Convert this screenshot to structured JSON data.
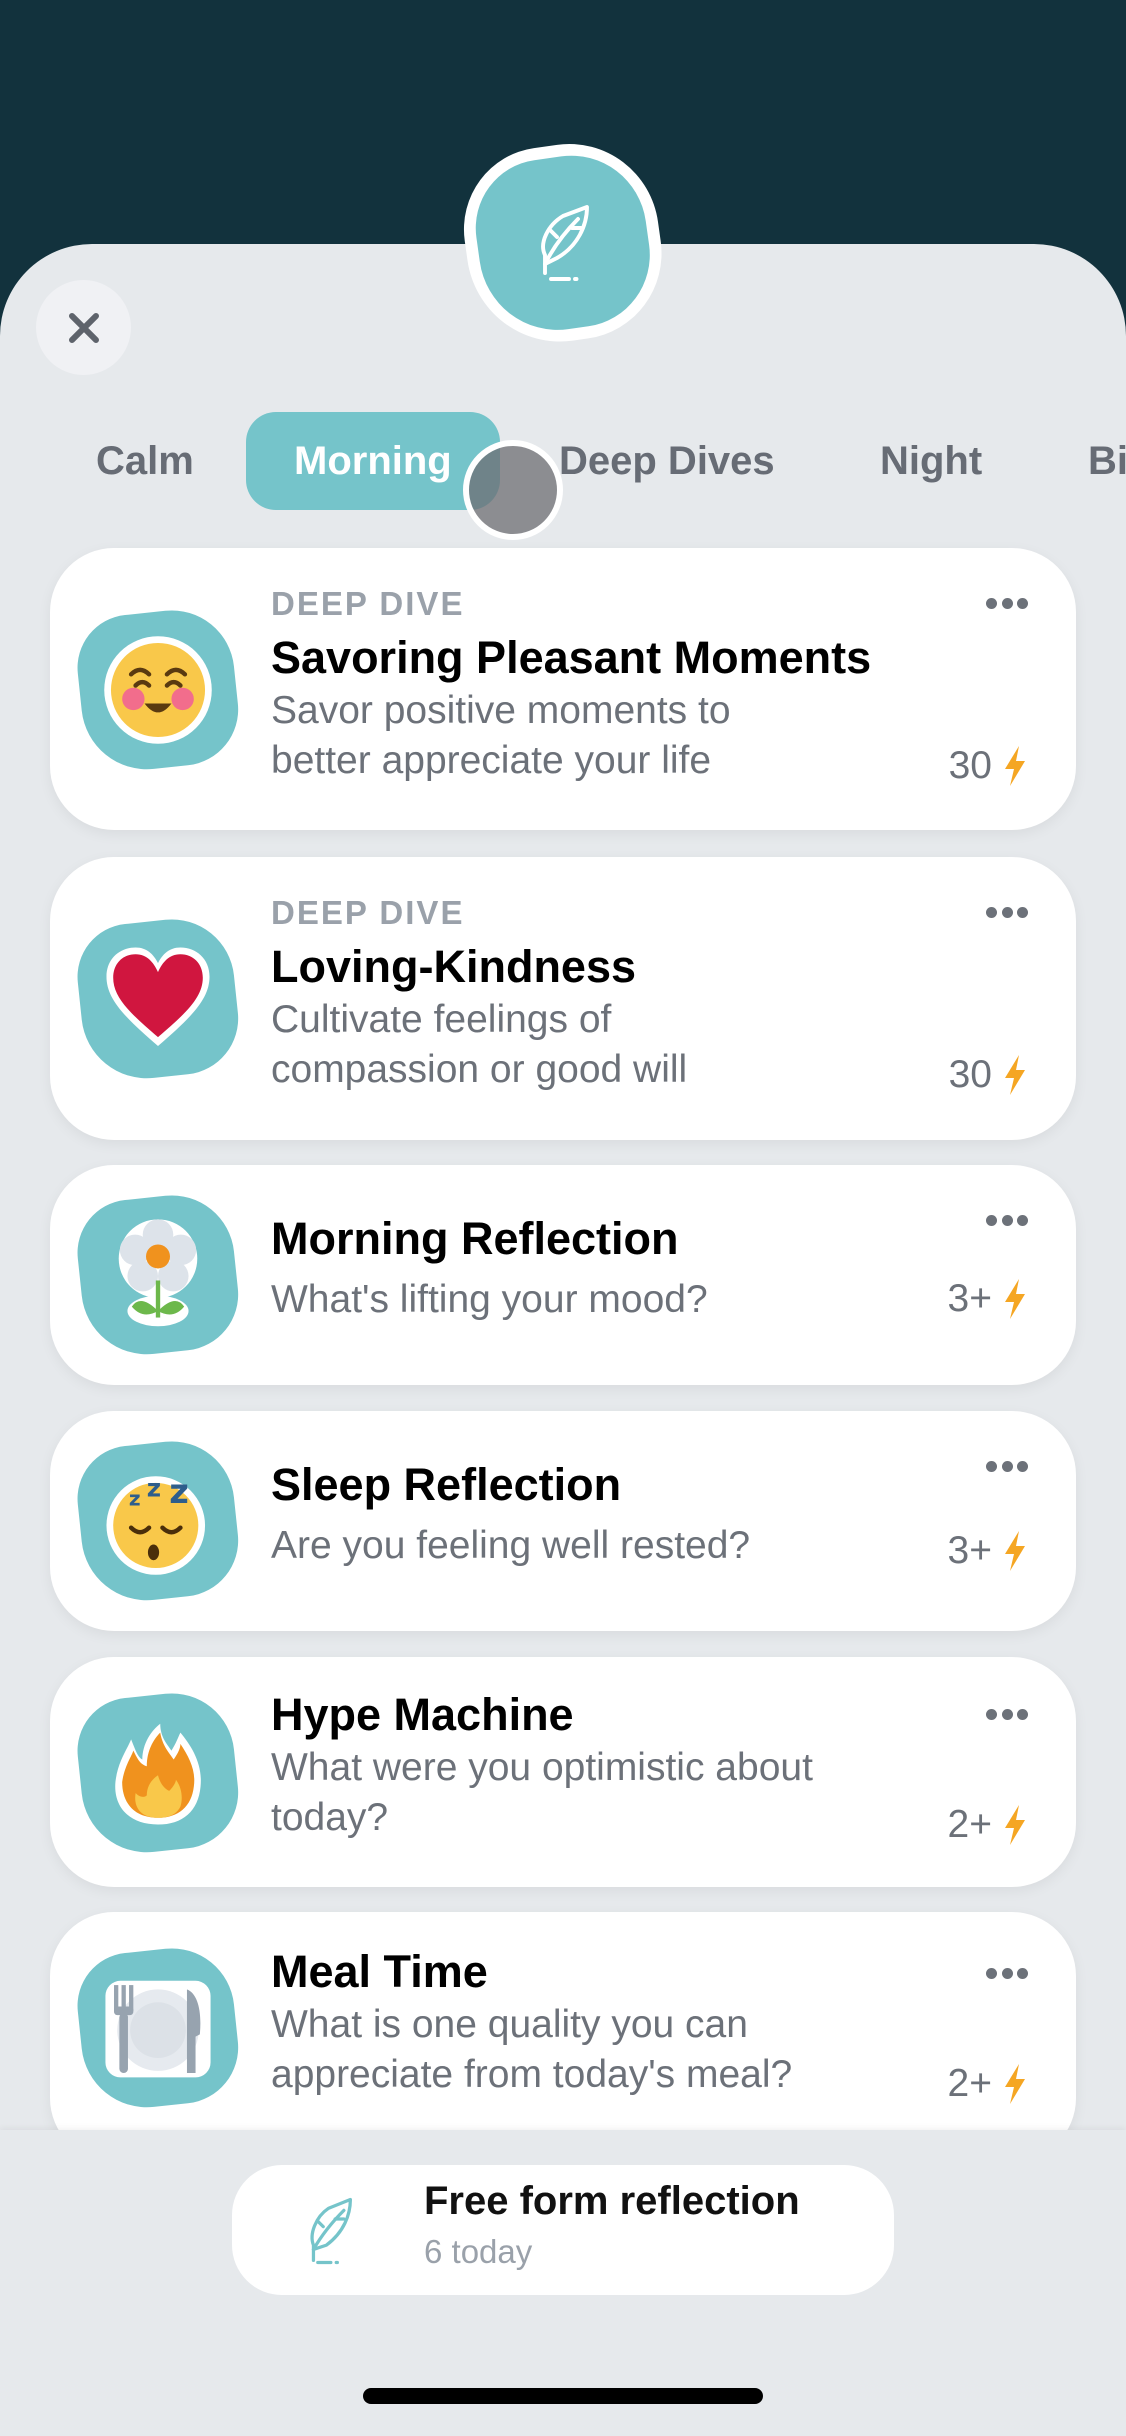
{
  "header": {
    "badge_icon": "feather-quill-icon",
    "close_icon": "close-icon"
  },
  "tabs": [
    {
      "label": "Calm",
      "active": false
    },
    {
      "label": "Morning",
      "active": true
    },
    {
      "label": "Deep Dives",
      "active": false
    },
    {
      "label": "Night",
      "active": false
    },
    {
      "label": "Bi",
      "active": false
    }
  ],
  "cards": [
    {
      "kicker": "DEEP DIVE",
      "title": "Savoring Pleasant Moments",
      "desc_lines": [
        "Savor positive moments to",
        "better appreciate your life"
      ],
      "points": "30",
      "icon": "smiling-face-icon"
    },
    {
      "kicker": "DEEP DIVE",
      "title": "Loving-Kindness",
      "desc_lines": [
        "Cultivate feelings of",
        "compassion or good will"
      ],
      "points": "30",
      "icon": "heart-icon"
    },
    {
      "kicker": "",
      "title": "Morning Reflection",
      "desc_lines": [
        "What's lifting your mood?"
      ],
      "points": "3+",
      "icon": "flower-icon"
    },
    {
      "kicker": "",
      "title": "Sleep Reflection",
      "desc_lines": [
        "Are you feeling well rested?"
      ],
      "points": "3+",
      "icon": "sleeping-face-icon"
    },
    {
      "kicker": "",
      "title": "Hype Machine",
      "desc_lines": [
        "What were you optimistic about",
        "today?"
      ],
      "points": "2+",
      "icon": "fire-icon"
    },
    {
      "kicker": "",
      "title": "Meal Time",
      "desc_lines": [
        "What is one quality you can",
        "appreciate from today's meal?"
      ],
      "points": "2+",
      "icon": "plate-fork-knife-icon"
    }
  ],
  "footer": {
    "free_form_title": "Free form reflection",
    "free_form_sub": "6 today",
    "icon": "feather-quill-icon"
  },
  "colors": {
    "accent": "#75C4CA",
    "background_dark": "#12323D",
    "sheet": "#E6E9EC",
    "bolt": "#F5A623"
  }
}
